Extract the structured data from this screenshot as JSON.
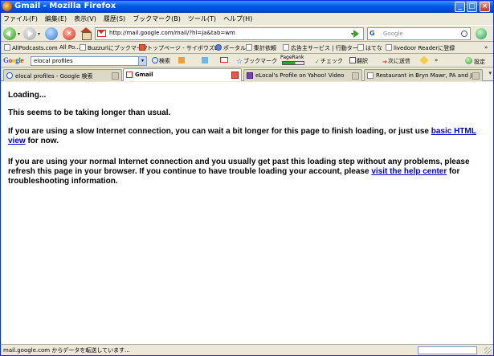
{
  "window": {
    "title": "Gmail - Mozilla Firefox",
    "minimize_glyph": "_",
    "maximize_glyph": "□",
    "close_glyph": "×"
  },
  "menu": [
    "ファイル(F)",
    "編集(E)",
    "表示(V)",
    "履歴(S)",
    "ブックマーク(B)",
    "ツール(T)",
    "ヘルプ(H)"
  ],
  "nav": {
    "url": "http://mail.google.com/mail/?hl=ja&tab=wm",
    "search_placeholder": "Google",
    "dropdown_glyph": "▾"
  },
  "bookmarks": [
    {
      "label": "AllPodcasts.com",
      "icon": "page-icon"
    },
    {
      "label": "All Po...",
      "icon": "page-icon"
    },
    {
      "label": "Buzzurlにブックマーク",
      "icon": "page-icon"
    },
    {
      "label": "トップページ - サイボウズL",
      "icon": "red-icon"
    },
    {
      "label": "ポータル",
      "icon": "blue-icon"
    },
    {
      "label": "集計依頼",
      "icon": "page-icon"
    },
    {
      "label": "広告主サービス | 行動ター...",
      "icon": "page-icon"
    },
    {
      "label": "はてな",
      "icon": "page-icon"
    },
    {
      "label": "livedoor Readerに登録",
      "icon": "page-icon"
    }
  ],
  "google_toolbar": {
    "logo": [
      "G",
      "o",
      "o",
      "g",
      "l",
      "e"
    ],
    "query": "elocal profiles",
    "search_label": "検索",
    "bookmark_label": "ブックマーク",
    "pagerank_label": "PageRank",
    "check_label": "チェック",
    "translate_label": "翻訳",
    "send_label": "次に送信",
    "more_glyph": "»",
    "settings_label": "設定"
  },
  "tabs": [
    {
      "label": "elocal profiles - Google 検索",
      "active": false
    },
    {
      "label": "Gmail",
      "active": true
    },
    {
      "label": "eLocal's Profile on Yahoo! Video",
      "active": false
    },
    {
      "label": "Restaurant in Bryn Mawr, PA and Ja...",
      "active": false
    }
  ],
  "content": {
    "loading": "Loading...",
    "slow": "This seems to be taking longer than usual.",
    "p1_pre": "If you are using a slow Internet connection, you can wait a bit longer for this page to finish loading, or just use ",
    "p1_link": "basic HTML view",
    "p1_post": " for now.",
    "p2_pre": "If you are using your normal Internet connection and you usually get past this loading step without any problems, please refresh this page in your browser. If you continue to have trouble loading your account, please ",
    "p2_link": "visit the help center",
    "p2_post": " for troubleshooting information."
  },
  "status": {
    "text": "mail.google.com からデータを転送しています..."
  }
}
